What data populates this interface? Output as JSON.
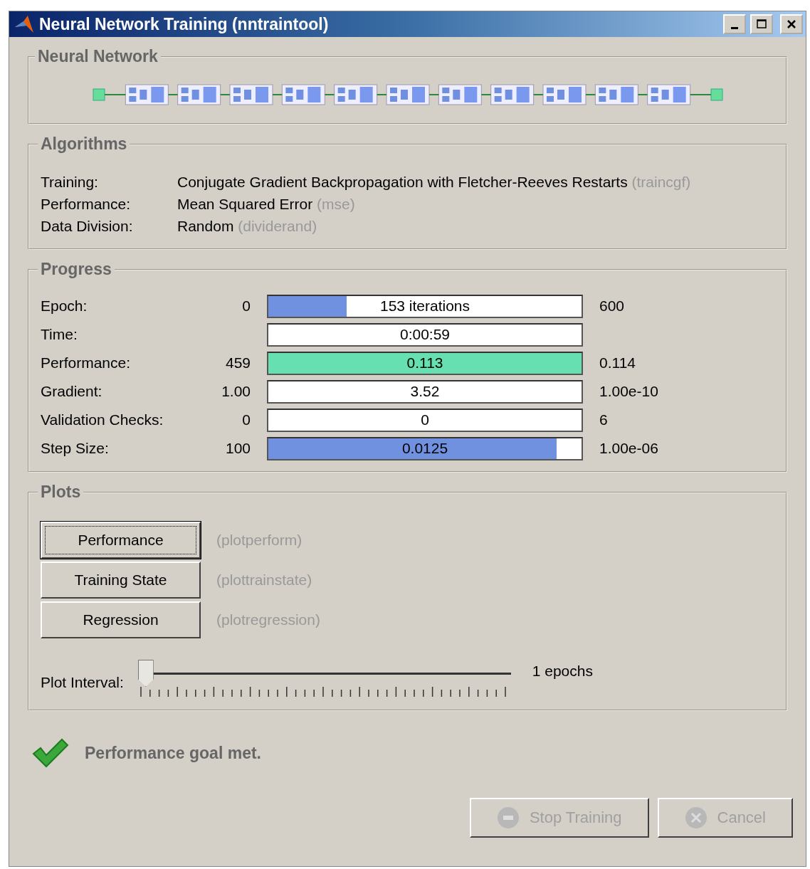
{
  "window": {
    "title": "Neural Network Training (nntraintool)"
  },
  "network": {
    "title": "Neural Network"
  },
  "algorithms": {
    "title": "Algorithms",
    "rows": [
      {
        "label": "Training:",
        "value": "Conjugate Gradient Backpropagation with Fletcher-Reeves Restarts",
        "function": "(traincgf)"
      },
      {
        "label": "Performance:",
        "value": "Mean Squared Error",
        "function": "(mse)"
      },
      {
        "label": "Data Division:",
        "value": "Random",
        "function": "(dividerand)"
      }
    ]
  },
  "progress": {
    "title": "Progress",
    "rows": [
      {
        "label": "Epoch:",
        "start": "0",
        "bar_text": "153 iterations",
        "level": 0.25,
        "color": "#7090e0",
        "end": "600"
      },
      {
        "label": "Time:",
        "bar_text": "0:00:59"
      },
      {
        "label": "Performance:",
        "start": "459",
        "bar_text": "0.113",
        "level": 1,
        "color": "#66e0b0",
        "end": "0.114"
      },
      {
        "label": "Gradient:",
        "start": "1.00",
        "bar_text": "3.52",
        "end": "1.00e-10"
      },
      {
        "label": "Validation Checks:",
        "start": "0",
        "bar_text": "0",
        "end": "6"
      },
      {
        "label": "Step Size:",
        "start": "100",
        "bar_text": "0.0125",
        "level": 0.92,
        "color": "#7090e0",
        "end": "1.00e-06"
      }
    ]
  },
  "plots": {
    "title": "Plots",
    "buttons": [
      {
        "label": "Performance",
        "function": "(plotperform)",
        "focused": true
      },
      {
        "label": "Training State",
        "function": "(plottrainstate)",
        "focused": false
      },
      {
        "label": "Regression",
        "function": "(plotregression)",
        "focused": false
      }
    ],
    "interval": {
      "label": "Plot Interval:",
      "level": 0,
      "reading": "1 epochs"
    }
  },
  "status": {
    "text": "Performance goal met."
  },
  "buttons": [
    {
      "label": "Stop Training",
      "kind": "stop",
      "disabled": true
    },
    {
      "label": "Cancel",
      "kind": "cancel",
      "disabled": true
    }
  ]
}
